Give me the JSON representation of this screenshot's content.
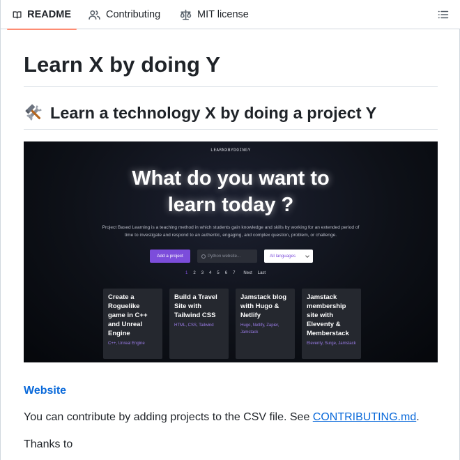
{
  "tabs": [
    {
      "label": "README",
      "icon": "book-icon",
      "active": true
    },
    {
      "label": "Contributing",
      "icon": "people-icon",
      "active": false
    },
    {
      "label": "MIT license",
      "icon": "law-icon",
      "active": false
    }
  ],
  "outline_icon": "list-unordered-icon",
  "readme": {
    "title": "Learn X by doing Y",
    "subtitle": "Learn a technology X by doing a project Y",
    "subtitle_emoji": "hammer-and-wrench-icon",
    "website_link": "Website",
    "contribute_text_before": "You can contribute by adding projects to the CSV file. See ",
    "contribute_link": "CONTRIBUTING.md",
    "contribute_text_after": ".",
    "thanks": "Thanks to"
  },
  "screenshot": {
    "brand": "LEARNXBYDOINGY",
    "headline_line1": "What do you want to",
    "headline_line2": "learn today ?",
    "description": "Project Based Learning is a teaching method in which students gain knowledge and skills by working for an extended period of time to investigate and respond to an authentic, engaging, and complex question, problem, or challenge.",
    "add_button": "Add a project",
    "search_placeholder": "Python website...",
    "select_value": "All languages",
    "pagination": [
      "1",
      "2",
      "3",
      "4",
      "5",
      "6",
      "7",
      "Next",
      "Last"
    ],
    "cards": [
      {
        "title": "Create a Roguelike game in C++ and Unreal Engine",
        "tags": "C++, Unreal Engine"
      },
      {
        "title": "Build a Travel Site with Tailwind CSS",
        "tags": "HTML, CSS, Tailwind"
      },
      {
        "title": "Jamstack blog with Hugo & Netlify",
        "tags": "Hugo, Netlify, Zapier, Jamstack"
      },
      {
        "title": "Jamstack membership site with Eleventy & Memberstack",
        "tags": "Eleventy, Surge, Jamstack"
      }
    ]
  },
  "colors": {
    "link": "#0969da",
    "accent_tab_underline": "#fd8c73",
    "purple": "#7c4ddb"
  }
}
